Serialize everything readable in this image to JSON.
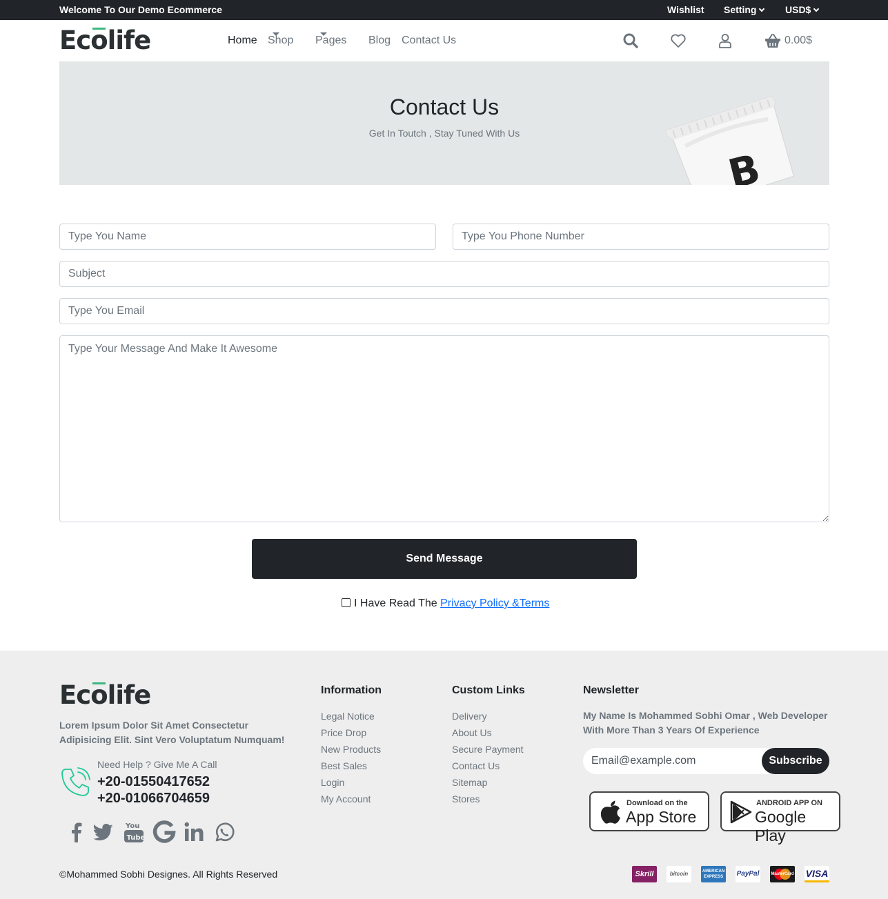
{
  "topbar": {
    "welcome": "Welcome To Our Demo Ecommerce",
    "wishlist": "Wishlist",
    "setting": "Setting",
    "currency": "USD$"
  },
  "brand": {
    "logo_text": "Ecolife"
  },
  "nav": {
    "home": "Home",
    "shop": "Shop",
    "pages": "Pages",
    "blog": "Blog",
    "contact": "Contact Us"
  },
  "header": {
    "cart_amount": "0.00$",
    "icons": [
      "search-icon",
      "heart-icon",
      "user-icon",
      "basket-icon"
    ]
  },
  "hero": {
    "title": "Contact Us",
    "subtitle": "Get In Toutch , Stay Tuned With Us",
    "package_letter": "B"
  },
  "form": {
    "name_placeholder": "Type You Name",
    "phone_placeholder": "Type You Phone Number",
    "subject_placeholder": "Subject",
    "email_placeholder": "Type You Email",
    "message_placeholder": "Type Your Message And Make It Awesome",
    "send_label": "Send Message",
    "agree_text": "I Have Read The ",
    "agree_link": "Privacy Policy &Terms"
  },
  "footer": {
    "description": "Lorem Ipsum Dolor Sit Amet Consectetur Adipisicing Elit. Sint Vero Voluptatum Numquam!",
    "help_text": "Need Help ? Give Me A Call",
    "phones": [
      "+20-01550417652",
      "+20-01066704659"
    ],
    "socials": [
      "facebook-icon",
      "twitter-icon",
      "youtube-icon",
      "google-icon",
      "linkedin-icon",
      "whatsapp-icon"
    ],
    "information": {
      "title": "Information",
      "links": [
        "Legal Notice",
        "Price Drop",
        "New Products",
        "Best Sales",
        "Login",
        "My Account"
      ]
    },
    "custom_links": {
      "title": "Custom Links",
      "links": [
        "Delivery",
        "About Us",
        "Secure Payment",
        "Contact Us",
        "Sitemap",
        "Stores"
      ]
    },
    "newsletter": {
      "title": "Newsletter",
      "text": "My Name Is Mohammed Sobhi Omar , Web Developer With More Than 3 Years Of Experience",
      "placeholder": "Email@example.com",
      "button": "Subscribe"
    },
    "app_store": {
      "small": "Download on the",
      "big": "App Store"
    },
    "google_play": {
      "small": "ANDROID APP ON",
      "big": "Google Play"
    },
    "copyright": "©Mohammed Sobhi Designes. All Rights Reserved",
    "payments": [
      "Skrill",
      "bitcoin",
      "AMERICAN EXPRESS",
      "PayPal",
      "MasterCard",
      "VISA"
    ]
  }
}
